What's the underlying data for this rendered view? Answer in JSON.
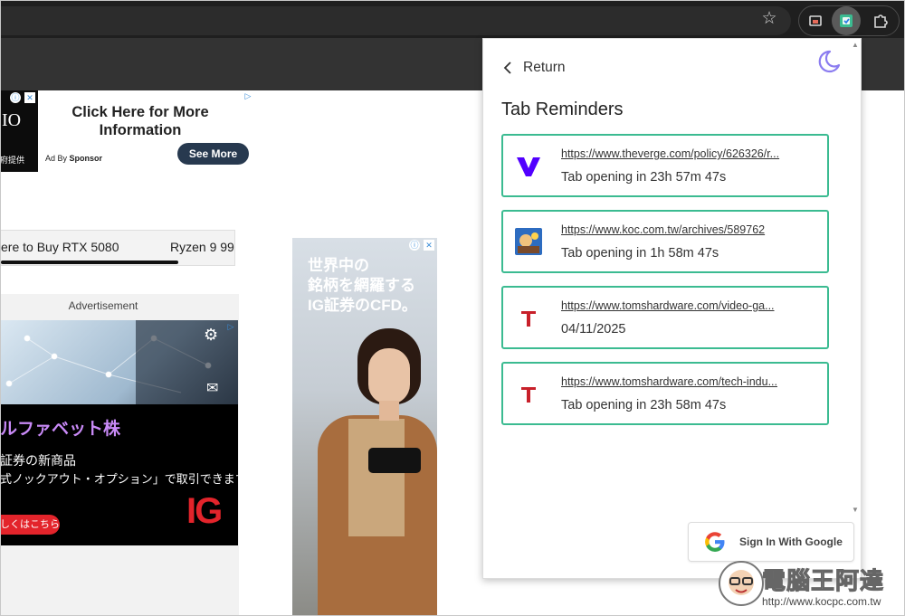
{
  "browser": {
    "bookmark_icon": "star-icon",
    "extensions": [
      "media-control-icon",
      "tab-reminder-extension-icon",
      "puzzle-extensions-icon"
    ]
  },
  "page": {
    "ad1": {
      "brand_text": "IO",
      "brand_sub": "府提供",
      "cta": "Click Here for More Information",
      "ad_by": "Ad By",
      "sponsor": "Sponsor",
      "button": "See More"
    },
    "strip": {
      "item1": "ere to Buy RTX 5080",
      "item2": "Ryzen 9 99"
    },
    "ad2": {
      "label": "Advertisement",
      "line1": "ルファベット株",
      "line2": "証券の新商品",
      "line3": "式ノックアウト・オプション」で取引できます。",
      "button": "しくはこちら",
      "logo": "IG"
    },
    "ad3": {
      "lines": [
        "世界中の",
        "銘柄を網羅する",
        "IG証券のCFD。"
      ]
    }
  },
  "popup": {
    "return_label": "Return",
    "theme_icon": "moon-icon",
    "title": "Tab Reminders",
    "reminders": [
      {
        "url": "https://www.theverge.com/policy/626326/r...",
        "status": "Tab opening in 23h 57m 47s",
        "favicon": "the-verge-icon",
        "color": "#5200ff"
      },
      {
        "url": "https://www.koc.com.tw/archives/589762",
        "status": "Tab opening in 1h 58m 47s",
        "favicon": "koc-site-icon",
        "color": "#2d6cc0"
      },
      {
        "url": "https://www.tomshardware.com/video-ga...",
        "status": "04/11/2025",
        "favicon": "toms-hardware-icon",
        "color": "#c8202a"
      },
      {
        "url": "https://www.tomshardware.com/tech-indu...",
        "status": "Tab opening in 23h 58m 47s",
        "favicon": "toms-hardware-icon",
        "color": "#c8202a"
      }
    ],
    "google_button": "Sign In With Google",
    "accent": "#3bbb91"
  },
  "watermark": {
    "brand": "電腦王阿達",
    "url": "http://www.kocpc.com.tw"
  }
}
